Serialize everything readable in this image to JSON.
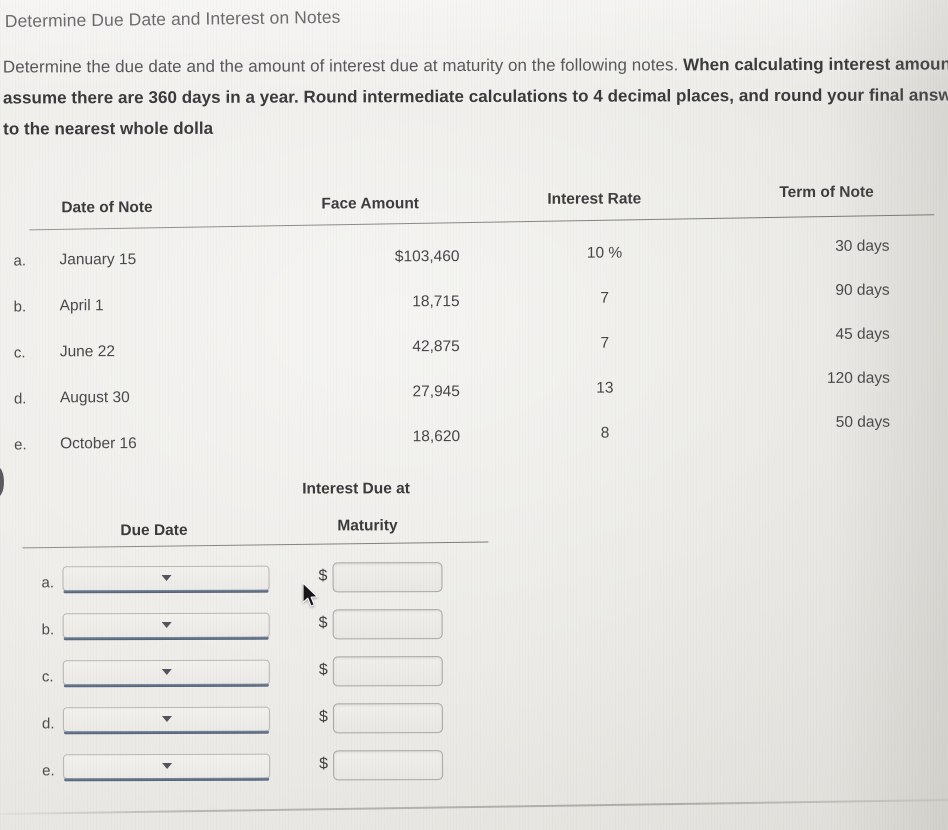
{
  "title": "Determine Due Date and Interest on Notes",
  "prompt": {
    "lead": "Determine the due date and the amount of interest due at maturity on the following notes. ",
    "strong": "When calculating interest amounts, assume there are 360 days in a year. Round intermediate calculations to 4 decimal places, and round your final answers to the nearest whole dolla"
  },
  "notes_table": {
    "headers": {
      "date_of_note": "Date of Note",
      "face_amount": "Face Amount",
      "interest_rate": "Interest Rate",
      "term_of_note": "Term of Note"
    },
    "rows": [
      {
        "letter": "a.",
        "date": "January 15",
        "face": "$103,460",
        "rate": "10 %",
        "term": "30 days"
      },
      {
        "letter": "b.",
        "date": "April 1",
        "face": "18,715",
        "rate": "7",
        "term": "90 days"
      },
      {
        "letter": "c.",
        "date": "June 22",
        "face": "42,875",
        "rate": "7",
        "term": "45 days"
      },
      {
        "letter": "d.",
        "date": "August 30",
        "face": "27,945",
        "rate": "13",
        "term": "120 days"
      },
      {
        "letter": "e.",
        "date": "October 16",
        "face": "18,620",
        "rate": "8",
        "term": "50 days"
      }
    ]
  },
  "answers": {
    "headers": {
      "interest_due_at": "Interest Due at",
      "due_date": "Due Date",
      "maturity": "Maturity"
    },
    "dollar_sign": "$",
    "select_placeholder": "",
    "amount_placeholder": "",
    "rows": [
      {
        "letter": "a.",
        "due_date_value": "",
        "amount_value": ""
      },
      {
        "letter": "b.",
        "due_date_value": "",
        "amount_value": ""
      },
      {
        "letter": "c.",
        "due_date_value": "",
        "amount_value": ""
      },
      {
        "letter": "d.",
        "due_date_value": "",
        "amount_value": ""
      },
      {
        "letter": "e.",
        "due_date_value": "",
        "amount_value": ""
      }
    ]
  },
  "edge_glyph": ")",
  "colors": {
    "paper": "#ebe9e5",
    "text": "#4a494b",
    "heading": "#3b3a3c",
    "select_underline": "#4e5d73",
    "rule": "#6f6e6c"
  }
}
